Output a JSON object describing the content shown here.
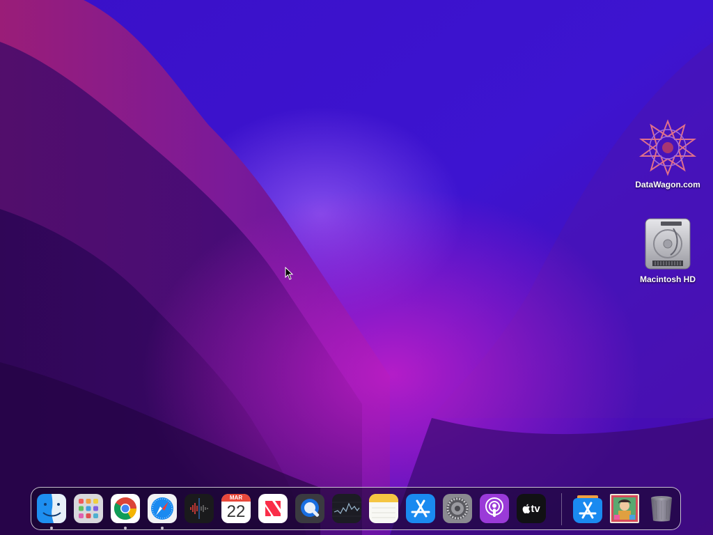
{
  "desktop": {
    "wallpaper": "macOS Monterey purple wallpaper",
    "icons": [
      {
        "label": "DataWagon.com",
        "icon": "datawagon-logo-icon"
      },
      {
        "label": "Macintosh HD",
        "icon": "hard-drive-icon"
      }
    ]
  },
  "dock": {
    "apps": [
      {
        "name": "Finder",
        "icon": "finder-icon",
        "running": true
      },
      {
        "name": "Launchpad",
        "icon": "launchpad-icon",
        "running": false
      },
      {
        "name": "Google Chrome",
        "icon": "chrome-icon",
        "running": true
      },
      {
        "name": "Safari",
        "icon": "safari-icon",
        "running": true
      },
      {
        "name": "Voice Memos",
        "icon": "voice-memos-icon",
        "running": false
      },
      {
        "name": "Calendar",
        "icon": "calendar-icon",
        "running": false,
        "month": "MAR",
        "day": "22"
      },
      {
        "name": "News",
        "icon": "news-icon",
        "running": false
      },
      {
        "name": "QuickTime Player",
        "icon": "quicktime-icon",
        "running": false
      },
      {
        "name": "Stocks",
        "icon": "stocks-icon",
        "running": false
      },
      {
        "name": "Notes",
        "icon": "notes-icon",
        "running": false
      },
      {
        "name": "App Store",
        "icon": "app-store-icon",
        "running": false
      },
      {
        "name": "System Preferences",
        "icon": "system-preferences-icon",
        "running": false
      },
      {
        "name": "Podcasts",
        "icon": "podcasts-icon",
        "running": false
      },
      {
        "name": "TV",
        "icon": "apple-tv-icon",
        "running": false,
        "label": "tv"
      }
    ],
    "others": [
      {
        "name": "Applications",
        "icon": "applications-folder-icon"
      },
      {
        "name": "Downloads",
        "icon": "downloads-stack-icon"
      },
      {
        "name": "Trash",
        "icon": "trash-icon"
      }
    ]
  },
  "colors": {
    "wallpaper_base": "#2a0a8a",
    "wallpaper_red": "#b0246e",
    "wallpaper_magenta": "#a01ac0",
    "dock_border": "#ffffff"
  }
}
